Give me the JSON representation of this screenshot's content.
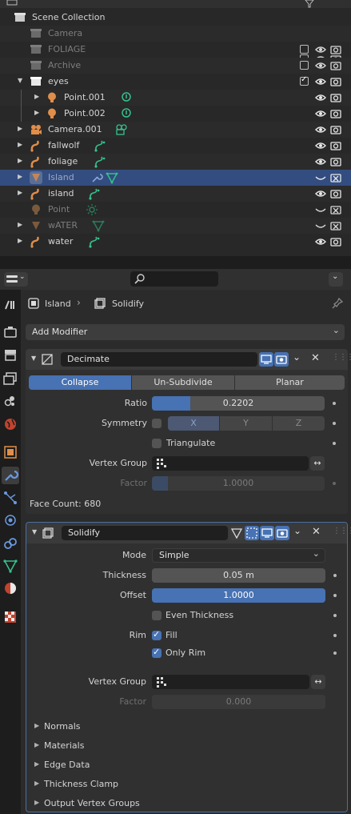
{
  "outliner": {
    "root_label": "Scene Collection",
    "rows": [
      {
        "label": "Camera",
        "icon": "collection-icon",
        "dimmed": true,
        "checked": false
      },
      {
        "label": "FOLIAGE",
        "icon": "collection-icon",
        "dimmed": true,
        "checked": false
      },
      {
        "label": "Archive",
        "icon": "collection-icon",
        "dimmed": true,
        "checked": false
      },
      {
        "label": "eyes",
        "icon": "collection-icon",
        "dimmed": false,
        "checked": true
      },
      {
        "label": "Point.001",
        "icon": "light-icon"
      },
      {
        "label": "Point.002",
        "icon": "light-icon"
      },
      {
        "label": "Camera.001",
        "icon": "camera-object-icon"
      },
      {
        "label": "fallwolf",
        "icon": "armature-icon"
      },
      {
        "label": "foliage",
        "icon": "armature-icon"
      },
      {
        "label": "Island",
        "icon": "mesh-object-icon",
        "selected": true
      },
      {
        "label": "island",
        "icon": "armature-icon"
      },
      {
        "label": "Point",
        "icon": "light-icon",
        "dimmed": true
      },
      {
        "label": "wATER",
        "icon": "mesh-object-icon",
        "dimmed": true
      },
      {
        "label": "water",
        "icon": "armature-icon"
      }
    ]
  },
  "properties": {
    "breadcrumb_object": "Island",
    "breadcrumb_modifier": "Solidify",
    "add_modifier_label": "Add Modifier",
    "decimate": {
      "name": "Decimate",
      "tabs": [
        "Collapse",
        "Un-Subdivide",
        "Planar"
      ],
      "active_tab": "Collapse",
      "ratio_label": "Ratio",
      "ratio_value": "0.2202",
      "ratio_fraction": 0.2202,
      "symmetry_label": "Symmetry",
      "symmetry_axes": [
        "X",
        "Y",
        "Z"
      ],
      "triangulate_label": "Triangulate",
      "vertex_group_label": "Vertex Group",
      "factor_label": "Factor",
      "factor_value": "1.0000",
      "face_count_label": "Face Count: 680"
    },
    "solidify": {
      "name": "Solidify",
      "mode_label": "Mode",
      "mode_value": "Simple",
      "thickness_label": "Thickness",
      "thickness_value": "0.05 m",
      "offset_label": "Offset",
      "offset_value": "1.0000",
      "even_thickness_label": "Even Thickness",
      "rim_label": "Rim",
      "fill_label": "Fill",
      "only_rim_label": "Only Rim",
      "vertex_group_label": "Vertex Group",
      "factor_label": "Factor",
      "factor_value": "0.000",
      "subpanels": [
        "Normals",
        "Materials",
        "Edge Data",
        "Thickness Clamp",
        "Output Vertex Groups"
      ]
    }
  },
  "colors": {
    "accent": "#4772b3",
    "selected_row": "#334d80",
    "light_icon": "#e08e4a",
    "armature_icon": "#35c08c"
  }
}
